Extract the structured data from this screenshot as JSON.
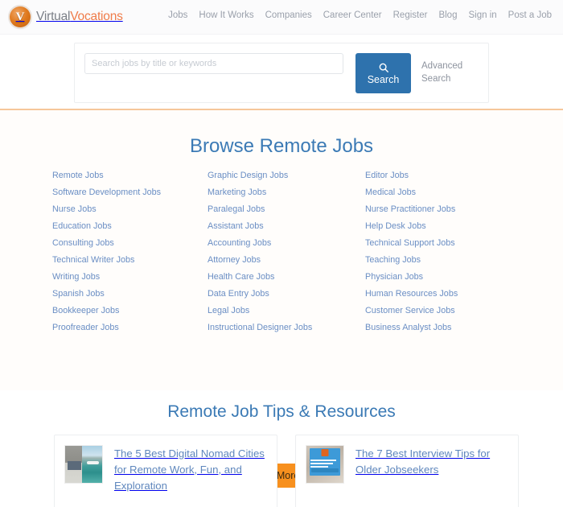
{
  "header": {
    "logo": {
      "badge_letter": "V",
      "name_part1": "Virtual",
      "name_part2": "Vocations"
    },
    "nav_items": [
      {
        "label": "Jobs"
      },
      {
        "label": "How It Works"
      },
      {
        "label": "Companies"
      },
      {
        "label": "Career Center"
      },
      {
        "label": "Register"
      },
      {
        "label": "Blog"
      },
      {
        "label": "Sign in"
      },
      {
        "label": "Post a Job"
      }
    ]
  },
  "search": {
    "placeholder": "Search jobs by title or keywords",
    "value": "",
    "button_label": "Search",
    "button_icon": "search-icon",
    "advanced_label": "Advanced Search",
    "button_color": "#2e72ad"
  },
  "browse": {
    "title": "Browse Remote Jobs",
    "title_color": "#3b7ab5",
    "link_color": "#6a8ec4",
    "columns": [
      [
        "Remote Jobs",
        "Software Development Jobs",
        "Nurse Jobs",
        "Education Jobs",
        "Consulting Jobs",
        "Technical Writer Jobs",
        "Writing Jobs",
        "Spanish Jobs",
        "Bookkeeper Jobs",
        "Proofreader Jobs"
      ],
      [
        "Graphic Design Jobs",
        "Marketing Jobs",
        "Paralegal Jobs",
        "Assistant Jobs",
        "Accounting Jobs",
        "Attorney Jobs",
        "Health Care Jobs",
        "Data Entry Jobs",
        "Legal Jobs",
        "Instructional Designer Jobs"
      ],
      [
        "Editor Jobs",
        "Medical Jobs",
        "Nurse Practitioner Jobs",
        "Help Desk Jobs",
        "Technical Support Jobs",
        "Teaching Jobs",
        "Physician Jobs",
        "Human Resources Jobs",
        "Customer Service Jobs",
        "Business Analyst Jobs"
      ]
    ],
    "more_button_label": "Browse More Jobs",
    "more_button_color": "#f7901e"
  },
  "tips": {
    "title": "Remote Job Tips & Resources",
    "cards": [
      {
        "title": "The 5 Best Digital Nomad Cities for Remote Work, Fun, and Exploration",
        "thumbnail": "beach-ocean-thumbnail"
      },
      {
        "title": "The 7 Best Interview Tips for Older Jobseekers",
        "thumbnail": "blue-quote-card-thumbnail"
      }
    ]
  }
}
